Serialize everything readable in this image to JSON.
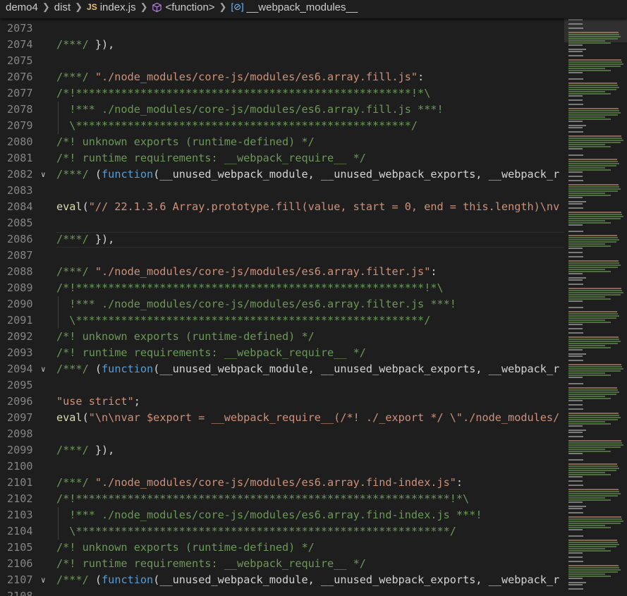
{
  "breadcrumb": {
    "items": [
      "demo4",
      "dist",
      "index.js",
      "<function>",
      "__webpack_modules__"
    ],
    "js_badge": "JS",
    "module_icon": "[⊘]"
  },
  "editor": {
    "lines": [
      {
        "n": "2073",
        "segs": []
      },
      {
        "n": "2074",
        "segs": [
          {
            "c": "c",
            "t": "/***/ "
          },
          {
            "c": "p",
            "t": "}),"
          }
        ]
      },
      {
        "n": "2075",
        "segs": []
      },
      {
        "n": "2076",
        "segs": [
          {
            "c": "c",
            "t": "/***/ "
          },
          {
            "c": "s",
            "t": "\"./node_modules/core-js/modules/es6.array.fill.js\""
          },
          {
            "c": "p",
            "t": ":"
          }
        ]
      },
      {
        "n": "2077",
        "segs": [
          {
            "c": "c",
            "t": "/*!****************************************************!*\\"
          }
        ]
      },
      {
        "n": "2078",
        "segs": [
          {
            "c": "c",
            "t": "  !*** ./node_modules/core-js/modules/es6.array.fill.js ***!"
          }
        ]
      },
      {
        "n": "2079",
        "segs": [
          {
            "c": "c",
            "t": "  \\****************************************************/"
          }
        ]
      },
      {
        "n": "2080",
        "segs": [
          {
            "c": "c",
            "t": "/*! unknown exports (runtime-defined) */"
          }
        ]
      },
      {
        "n": "2081",
        "segs": [
          {
            "c": "c",
            "t": "/*! runtime requirements: __webpack_require__ */"
          }
        ]
      },
      {
        "n": "2082",
        "fold": true,
        "segs": [
          {
            "c": "c",
            "t": "/***/ "
          },
          {
            "c": "p",
            "t": "("
          },
          {
            "c": "k",
            "t": "function"
          },
          {
            "c": "p",
            "t": "(__unused_webpack_module, __unused_webpack_exports, __webpack_r"
          }
        ]
      },
      {
        "n": "2083",
        "segs": []
      },
      {
        "n": "2084",
        "segs": [
          {
            "c": "fn",
            "t": "eval"
          },
          {
            "c": "p",
            "t": "("
          },
          {
            "c": "s",
            "t": "\"// 22.1.3.6 Array.prototype.fill(value, start = 0, end = this.length)\\nv"
          }
        ]
      },
      {
        "n": "2085",
        "segs": []
      },
      {
        "n": "2086",
        "cur": true,
        "segs": [
          {
            "c": "c",
            "t": "/***/ "
          },
          {
            "c": "p",
            "t": "}),"
          }
        ]
      },
      {
        "n": "2087",
        "segs": []
      },
      {
        "n": "2088",
        "segs": [
          {
            "c": "c",
            "t": "/***/ "
          },
          {
            "c": "s",
            "t": "\"./node_modules/core-js/modules/es6.array.filter.js\""
          },
          {
            "c": "p",
            "t": ":"
          }
        ]
      },
      {
        "n": "2089",
        "segs": [
          {
            "c": "c",
            "t": "/*!******************************************************!*\\"
          }
        ]
      },
      {
        "n": "2090",
        "segs": [
          {
            "c": "c",
            "t": "  !*** ./node_modules/core-js/modules/es6.array.filter.js ***!"
          }
        ]
      },
      {
        "n": "2091",
        "segs": [
          {
            "c": "c",
            "t": "  \\******************************************************/"
          }
        ]
      },
      {
        "n": "2092",
        "segs": [
          {
            "c": "c",
            "t": "/*! unknown exports (runtime-defined) */"
          }
        ]
      },
      {
        "n": "2093",
        "segs": [
          {
            "c": "c",
            "t": "/*! runtime requirements: __webpack_require__ */"
          }
        ]
      },
      {
        "n": "2094",
        "fold": true,
        "segs": [
          {
            "c": "c",
            "t": "/***/ "
          },
          {
            "c": "p",
            "t": "("
          },
          {
            "c": "k",
            "t": "function"
          },
          {
            "c": "p",
            "t": "(__unused_webpack_module, __unused_webpack_exports, __webpack_r"
          }
        ]
      },
      {
        "n": "2095",
        "segs": []
      },
      {
        "n": "2096",
        "segs": [
          {
            "c": "s",
            "t": "\"use strict\""
          },
          {
            "c": "p",
            "t": ";"
          }
        ]
      },
      {
        "n": "2097",
        "segs": [
          {
            "c": "fn",
            "t": "eval"
          },
          {
            "c": "p",
            "t": "("
          },
          {
            "c": "s",
            "t": "\"\\n\\nvar $export = __webpack_require__(/*! ./_export */ \\\"./node_modules/"
          }
        ]
      },
      {
        "n": "2098",
        "segs": []
      },
      {
        "n": "2099",
        "segs": [
          {
            "c": "c",
            "t": "/***/ "
          },
          {
            "c": "p",
            "t": "}),"
          }
        ]
      },
      {
        "n": "2100",
        "segs": []
      },
      {
        "n": "2101",
        "segs": [
          {
            "c": "c",
            "t": "/***/ "
          },
          {
            "c": "s",
            "t": "\"./node_modules/core-js/modules/es6.array.find-index.js\""
          },
          {
            "c": "p",
            "t": ":"
          }
        ]
      },
      {
        "n": "2102",
        "segs": [
          {
            "c": "c",
            "t": "/*!**********************************************************!*\\"
          }
        ]
      },
      {
        "n": "2103",
        "segs": [
          {
            "c": "c",
            "t": "  !*** ./node_modules/core-js/modules/es6.array.find-index.js ***!"
          }
        ]
      },
      {
        "n": "2104",
        "segs": [
          {
            "c": "c",
            "t": "  \\**********************************************************/"
          }
        ]
      },
      {
        "n": "2105",
        "segs": [
          {
            "c": "c",
            "t": "/*! unknown exports (runtime-defined) */"
          }
        ]
      },
      {
        "n": "2106",
        "segs": [
          {
            "c": "c",
            "t": "/*! runtime requirements: __webpack_require__ */"
          }
        ]
      },
      {
        "n": "2107",
        "fold": true,
        "segs": [
          {
            "c": "c",
            "t": "/***/ "
          },
          {
            "c": "p",
            "t": "("
          },
          {
            "c": "k",
            "t": "function"
          },
          {
            "c": "p",
            "t": "(__unused_webpack_module, __unused_webpack_exports, __webpack_r"
          }
        ]
      },
      {
        "n": "2108",
        "segs": []
      }
    ]
  },
  "colors": {
    "background": "#1e1e1e",
    "comment": "#6a9955",
    "string": "#ce9178",
    "keyword": "#569cd6",
    "function": "#dcdcaa",
    "line_number": "#858585"
  }
}
